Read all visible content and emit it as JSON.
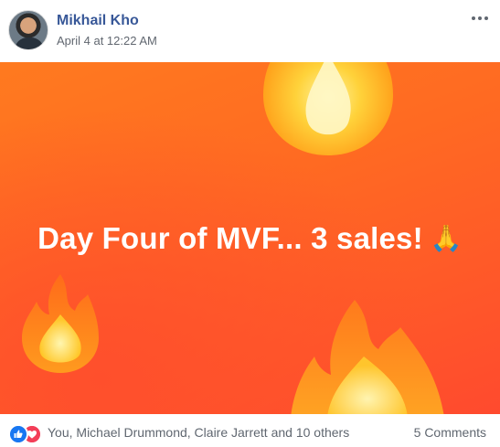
{
  "post": {
    "author": "Mikhail Kho",
    "timestamp": "April 4 at 12:22 AM",
    "more_icon": "ellipsis-icon",
    "banner": {
      "text": "Day Four of MVF... 3 sales!",
      "emoji": "🙏",
      "background_color": "#ff6a22",
      "decorations": [
        "fire-icon",
        "fire-icon",
        "fire-icon"
      ]
    },
    "reactions": {
      "icons": [
        "like-icon",
        "love-icon"
      ],
      "like_color": "#1877f2",
      "love_color": "#f33e58",
      "summary": "You, Michael Drummond, Claire Jarrett and 10 others"
    },
    "comments_count": "5 Comments"
  }
}
